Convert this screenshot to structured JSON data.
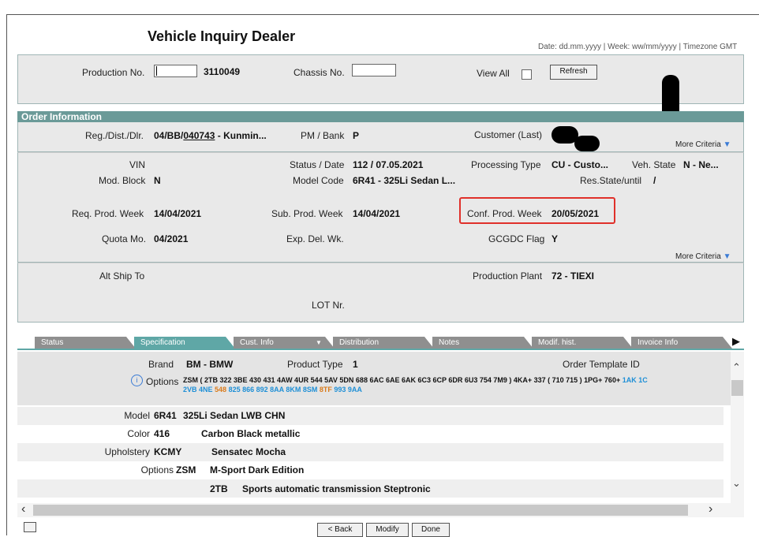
{
  "page": {
    "title": "Vehicle Inquiry Dealer",
    "date_hint_prefix": "Date: dd.mm.yyyy | Week: ww/mm/yyyy | ",
    "date_hint_tz": "Timezone GMT"
  },
  "search": {
    "production_no_label": "Production No.",
    "production_no_input": "",
    "production_no_value": "3110049",
    "chassis_no_label": "Chassis No.",
    "chassis_no_input": "",
    "view_all_label": "View All",
    "refresh_label": "Refresh"
  },
  "order": {
    "header": "Order Information",
    "reg_label": "Reg./Dist./Dlr.",
    "reg_prefix": "04/BB/",
    "reg_link": "040743",
    "reg_suffix": " - Kunmin...",
    "pm_bank_label": "PM / Bank",
    "pm_bank_value": "P",
    "customer_label": "Customer (Last)",
    "customer_value": "",
    "more_criteria": "More Criteria",
    "vin_label": "VIN",
    "vin_value": "",
    "status_label": "Status / Date",
    "status_value": "112 /  07.05.2021",
    "processing_type_label": "Processing Type",
    "processing_type_value": "CU - Custo...",
    "veh_state_label": "Veh. State",
    "veh_state_value": "N - Ne...",
    "mod_block_label": "Mod. Block",
    "mod_block_value": "N",
    "model_code_label": "Model Code",
    "model_code_value": "6R41 - 325Li Sedan L...",
    "res_state_label": "Res.State/until",
    "res_state_value": "/",
    "req_prod_week_label": "Req. Prod. Week",
    "req_prod_week_value": "14/04/2021",
    "sub_prod_week_label": "Sub. Prod. Week",
    "sub_prod_week_value": "14/04/2021",
    "conf_prod_week_label": "Conf. Prod. Week",
    "conf_prod_week_value": "20/05/2021",
    "quota_label": "Quota Mo.",
    "quota_value": "04/2021",
    "exp_del_label": "Exp. Del. Wk.",
    "exp_del_value": "",
    "gcgdc_label": "GCGDC Flag",
    "gcgdc_value": "Y",
    "more_criteria_2": "More Criteria",
    "alt_ship_label": "Alt Ship To",
    "alt_ship_value": "",
    "plant_label": "Production Plant",
    "plant_value": "72 - TIEXI",
    "lot_label": "LOT Nr.",
    "lot_value": ""
  },
  "tabs": [
    {
      "label": "Status"
    },
    {
      "label": "Specification"
    },
    {
      "label": "Cust. Info"
    },
    {
      "label": "Distribution"
    },
    {
      "label": "Notes"
    },
    {
      "label": "Modif. hist."
    },
    {
      "label": "Invoice Info"
    }
  ],
  "spec": {
    "brand_label": "Brand",
    "brand_value": "BM - BMW",
    "product_type_label": "Product Type",
    "product_type_value": "1",
    "order_template_label": "Order Template ID",
    "options_label": "Options",
    "options_line1_main": "ZSM ( 2TB 322 3BE 430 431 4AW 4UR 544 5AV 5DN 688 6AC 6AE 6AK 6C3 6CP 6DR 6U3 754 7M9 ) 4KA+ 337 ( 710 715 ) 1PG+ 760+",
    "options_line1_blue": "1AK 1C",
    "options_line2_blue1": "2VB 4NE",
    "options_line2_orange1": "548",
    "options_line2_blue2": "825 866 892 8AA 8KM 8SM",
    "options_line2_orange2": "8TF",
    "options_line2_blue3": "993 9AA",
    "rows": [
      {
        "label": "Model",
        "code": "6R41",
        "desc": "325Li Sedan LWB CHN"
      },
      {
        "label": "Color",
        "code": "416",
        "desc": "Carbon Black metallic"
      },
      {
        "label": "Upholstery",
        "code": "KCMY",
        "desc": "Sensatec Mocha"
      },
      {
        "label": "Options",
        "code": "ZSM",
        "desc": "M-Sport Dark Edition"
      },
      {
        "label": "",
        "code": "2TB",
        "desc": "Sports automatic transmission Steptronic"
      }
    ]
  },
  "footer": {
    "back_label": "< Back",
    "modify_label": "Modify",
    "done_label": "Done"
  },
  "colors": {
    "accent": "#6b9a98",
    "tab_active": "#5fa7a6",
    "highlight_border": "#e0302a",
    "option_blue": "#1e8fd6",
    "option_orange": "#d97a1a"
  }
}
